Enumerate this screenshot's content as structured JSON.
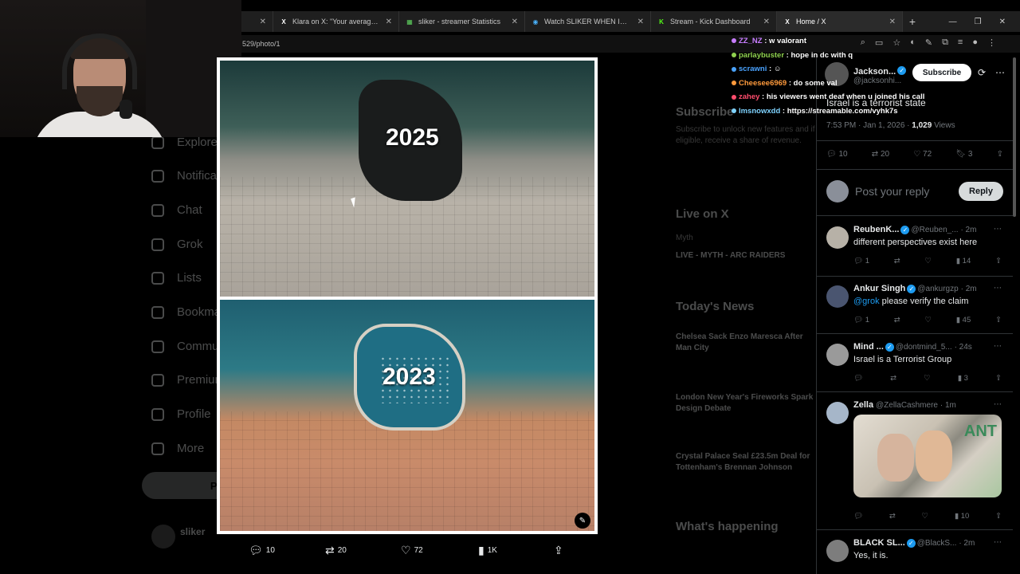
{
  "browser": {
    "tabs": [
      {
        "title": "",
        "active": false,
        "fav": ""
      },
      {
        "title": "Klara on X: \"Your average large",
        "active": false,
        "fav": "X"
      },
      {
        "title": "sliker - streamer Statistics",
        "active": false,
        "fav": "▦"
      },
      {
        "title": "Watch SLIKER WHEN IT COMES",
        "active": false,
        "fav": "◉"
      },
      {
        "title": "Stream - Kick Dashboard",
        "active": false,
        "fav": "K"
      },
      {
        "title": "Home / X",
        "active": true,
        "fav": "X"
      }
    ],
    "url": "529/photo/1"
  },
  "background_page": {
    "nav": [
      "Explore",
      "Notifications",
      "Chat",
      "Grok",
      "Lists",
      "Bookmarks",
      "Communities",
      "Premium",
      "Profile",
      "More"
    ],
    "post_button": "Post",
    "account_name": "sliker",
    "subscribe_heading": "Subscribe",
    "subscribe_text": "Subscribe to unlock new features and if eligible, receive a share of revenue.",
    "live_heading": "Live on X",
    "live_user": "Myth",
    "live_title": "LIVE - MYTH - ARC RAIDERS",
    "news_heading": "Today's News",
    "news": [
      "Chelsea Sack Enzo Maresca After Man City",
      "London New Year's Fireworks Spark Design Debate",
      "Crystal Palace Seal £23.5m Deal for Tottenham's Brennan Johnson"
    ],
    "happening_heading": "What's happening"
  },
  "photo": {
    "top_year": "2025",
    "bottom_year": "2023"
  },
  "photo_actions": {
    "replies": "10",
    "reposts": "20",
    "likes": "72",
    "views": "1K"
  },
  "chat": [
    {
      "user": "ZZ_NZ",
      "color": "#c77dff",
      "msg": "w valorant"
    },
    {
      "user": "parlaybuster",
      "color": "#8fd14f",
      "msg": "hope in dc with q"
    },
    {
      "user": "scrawni",
      "color": "#4aa3ff",
      "msg": ""
    },
    {
      "user": "Cheesee6969",
      "color": "#ff9a3c",
      "msg": "do some val"
    },
    {
      "user": "zahey",
      "color": "#ff4d6d",
      "msg": "his viewers went deaf when u joined his call"
    },
    {
      "user": "lmsnowxdd",
      "color": "#7fd3ff",
      "msg": "https://streamable.com/vyhk7s"
    }
  ],
  "tweet": {
    "author": "Jackson...",
    "handle": "@jacksonhi...",
    "subscribe": "Subscribe",
    "text": "Israel is a terrorist state",
    "time": "7:53 PM · Jan 1, 2026 · ",
    "views_count": "1,029",
    "views_label": " Views",
    "replies": "10",
    "reposts": "20",
    "likes": "72",
    "bookmarks": "3",
    "reply_placeholder": "Post your reply",
    "reply_button": "Reply"
  },
  "replies": [
    {
      "name": "ReubenK...",
      "handle": "@Reuben_...",
      "time": "· 2m",
      "mention": "",
      "text": "different perspectives exist here",
      "r": "1",
      "rt": "",
      "l": "",
      "v": "14"
    },
    {
      "name": "Ankur Singh",
      "handle": "@ankurgzp",
      "time": "· 2m",
      "mention": "@grok",
      "text": " please verify the claim",
      "r": "1",
      "rt": "",
      "l": "",
      "v": "45"
    },
    {
      "name": "Mind ...",
      "handle": "@dontmind_5...",
      "time": "· 24s",
      "mention": "",
      "text": "Israel is a Terrorist Group",
      "r": "",
      "rt": "",
      "l": "",
      "v": "3"
    },
    {
      "name": "Zella",
      "handle": "@ZellaCashmere",
      "time": "· 1m",
      "mention": "",
      "text": "",
      "r": "",
      "rt": "",
      "l": "",
      "v": "10"
    },
    {
      "name": "BLACK SL...",
      "handle": "@BlackS...",
      "time": "· 2m",
      "mention": "",
      "text": "Yes, it is.",
      "r": "",
      "rt": "",
      "l": "",
      "v": ""
    }
  ],
  "colors": {
    "accent": "#1d9bf0",
    "text": "#e7e9ea",
    "muted": "#71767b",
    "border": "#2f3336"
  }
}
